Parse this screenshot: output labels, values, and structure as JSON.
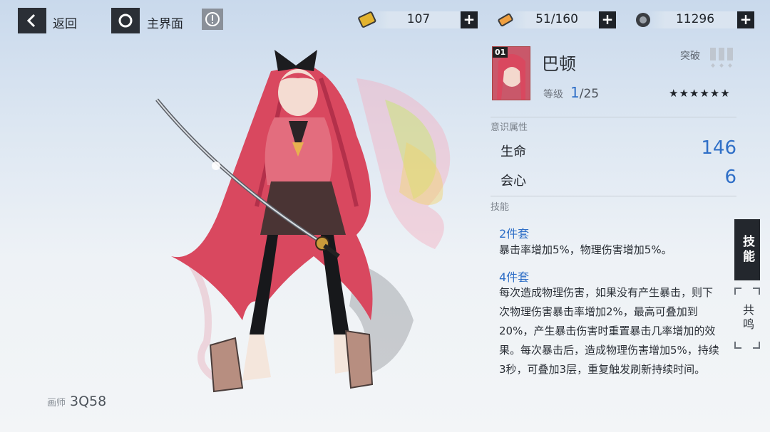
{
  "nav": {
    "back_label": "返回",
    "home_label": "主界面",
    "info_icon": "info-icon"
  },
  "resources": [
    {
      "icon": "gold-ticket-icon",
      "value": "107"
    },
    {
      "icon": "battery-icon",
      "value": "51/160"
    },
    {
      "icon": "gear-coin-icon",
      "value": "11296"
    }
  ],
  "artist": {
    "label": "画师",
    "name": "3Q58"
  },
  "memory": {
    "portrait_number": "01",
    "name": "巴顿",
    "breakthrough_label": "突破",
    "level_label": "等级",
    "level_current": "1",
    "level_max": "/25",
    "stars": "★★★★★★"
  },
  "attributes": {
    "section_label": "意识属性",
    "items": [
      {
        "name": "生命",
        "value": "146"
      },
      {
        "name": "会心",
        "value": "6"
      }
    ]
  },
  "skills": {
    "section_label": "技能",
    "set2_title": "2件套",
    "set2_desc": "暴击率增加5%，物理伤害增加5%。",
    "set4_title": "4件套",
    "set4_desc": "每次造成物理伤害，如果没有产生暴击，则下次物理伤害暴击率增加2%，最高可叠加到20%，产生暴击伤害时重置暴击几率增加的效果。每次暴击后，造成物理伤害增加5%，持续3秒，可叠加3层，重复触发刷新持续时间。"
  },
  "side_tabs": {
    "active": "技能",
    "inactive": "共鸣"
  },
  "colors": {
    "accent": "#2f6fc7",
    "dark": "#23272d"
  }
}
